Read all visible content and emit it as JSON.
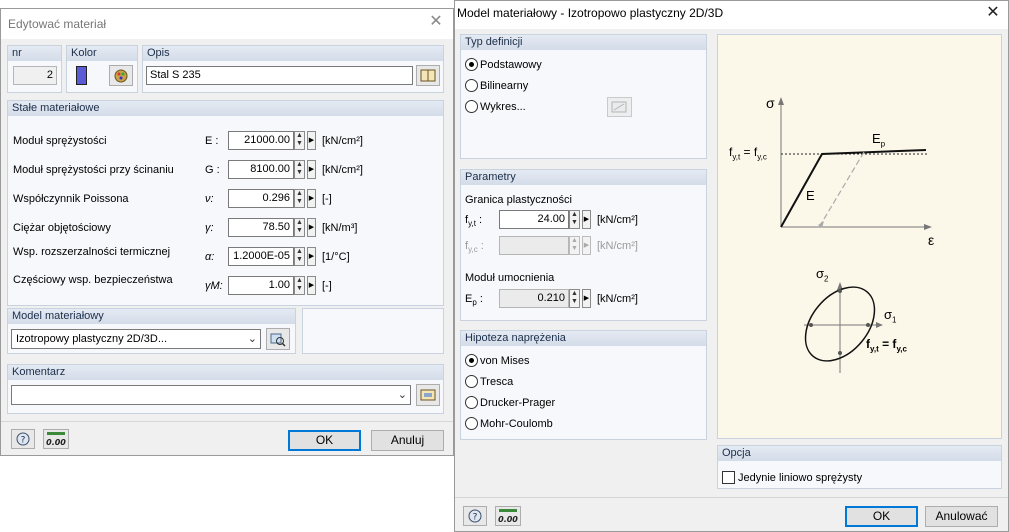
{
  "left_dialog": {
    "title": "Edytować materiał",
    "header": {
      "nr_label": "nr",
      "nr_value": "2",
      "color_label": "Kolor",
      "color_swatch": "#5b5bd6",
      "desc_label": "Opis",
      "desc_value": "Stal S 235"
    },
    "constants": {
      "title": "Stałe materiałowe",
      "rows": [
        {
          "label": "Moduł sprężystości",
          "symbol": "E :",
          "value": "21000.00",
          "unit": "[kN/cm²]"
        },
        {
          "label": "Moduł sprężystości przy ścinaniu",
          "symbol": "G :",
          "value": "8100.00",
          "unit": "[kN/cm²]"
        },
        {
          "label": "Współczynnik Poissona",
          "symbol": "ν:",
          "value": "0.296",
          "unit": "[-]"
        },
        {
          "label": "Ciężar objętościowy",
          "symbol": "γ:",
          "value": "78.50",
          "unit": "[kN/m³]"
        },
        {
          "label": "Wsp. rozszerzalności termicznej",
          "symbol": "α:",
          "value": "1.2000E-05",
          "unit": "[1/°C]"
        },
        {
          "label": "Częściowy wsp. bezpieczeństwa",
          "symbol": "γM:",
          "value": "1.00",
          "unit": "[-]"
        }
      ]
    },
    "model": {
      "title": "Model materiałowy",
      "selected": "Izotropowy plastyczny 2D/3D..."
    },
    "comment": {
      "title": "Komentarz",
      "value": ""
    },
    "buttons": {
      "ok": "OK",
      "cancel": "Anuluj"
    }
  },
  "right_dialog": {
    "title": "Model materiałowy - Izotropowo plastyczny 2D/3D",
    "definition": {
      "title": "Typ definicji",
      "options": [
        "Podstawowy",
        "Bilinearny",
        "Wykres..."
      ],
      "selected": "Podstawowy"
    },
    "params": {
      "title": "Parametry",
      "yield_title": "Granica plastyczności",
      "fyt_value": "24.00",
      "fyt_unit": "[kN/cm²]",
      "fyc_value": "",
      "fyc_unit": "[kN/cm²]",
      "hardening_title": "Moduł umocnienia",
      "ep_value": "0.210",
      "ep_unit": "[kN/cm²]"
    },
    "hypothesis": {
      "title": "Hipoteza naprężenia",
      "options": [
        "von Mises",
        "Tresca",
        "Drucker-Prager",
        "Mohr-Coulomb"
      ],
      "selected": "von Mises"
    },
    "option": {
      "title": "Opcja",
      "checkbox_label": "Jedynie liniowo sprężysty",
      "checked": false
    },
    "diagram": {
      "sigma": "σ",
      "epsilon": "ε",
      "fy_eq": "= f",
      "E": "E",
      "Ep": "E",
      "sigma1": "σ",
      "sigma2": "σ"
    },
    "buttons": {
      "ok": "OK",
      "cancel": "Anulować"
    }
  }
}
